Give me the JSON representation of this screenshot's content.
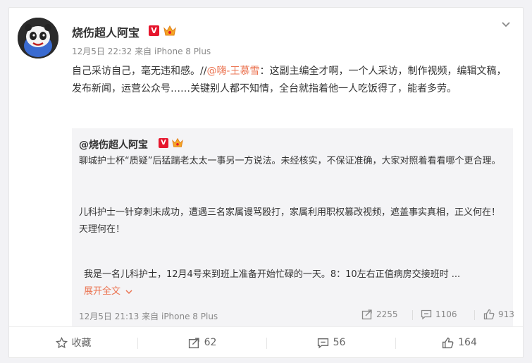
{
  "post": {
    "author": "烧伤超人阿宝",
    "vip_badge": "V",
    "timestamp": "12月5日 22:32",
    "source_prefix": "来自",
    "source": "iPhone 8 Plus",
    "text_part1": "自己采访自己，毫无违和感。//",
    "mention": "@嗨-王慕雪",
    "text_part2": "：这副主编全才啊，一个人采访，制作视频，编辑文稿，发布新闻，运营公众号……关键别人都不知情，全台就指着他一人吃饭得了，能者多劳。"
  },
  "quoted": {
    "author": "@烧伤超人阿宝",
    "vip_badge": "V",
    "paragraph1": "聊城护士杯“质疑”后猛踹老太太一事另一方说法。未经核实，不保证准确，大家对照着看看哪个更合理。",
    "paragraph2": "儿科护士一针穿刺未成功，遭遇三名家属谩骂殴打，家属利用职权篡改视频，遮盖事实真相，正义何在！天理何在！",
    "paragraph3": "我是一名儿科护士，12月4号来到班上准备开始忙碌的一天。8：10左右正值病房交接班时 ...",
    "expand_label": "展开全文",
    "timestamp": "12月5日 21:13",
    "source_prefix": "来自",
    "source": "iPhone 8 Plus",
    "reposts": "2255",
    "comments": "1106",
    "likes": "913"
  },
  "footer": {
    "favorite_label": "收藏",
    "repost_count": "62",
    "comment_count": "56",
    "like_count": "164"
  },
  "colors": {
    "mention": "#eb7350",
    "vip_badge": "#e6162d",
    "meta_text": "#888888"
  },
  "icons": [
    "chevron-down-icon",
    "crown-icon",
    "repost-icon",
    "comment-icon",
    "like-icon",
    "star-icon"
  ]
}
